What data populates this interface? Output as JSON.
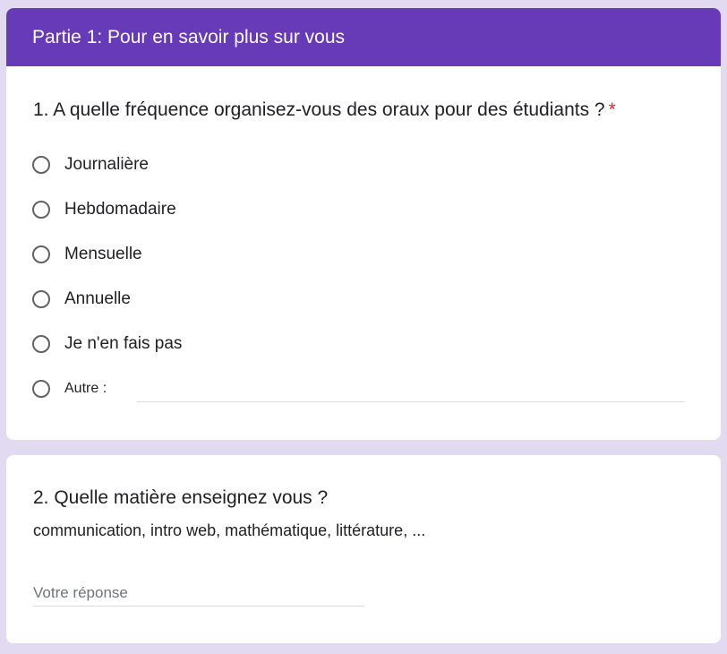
{
  "section": {
    "title": "Partie 1: Pour en savoir plus sur vous"
  },
  "question1": {
    "title": "1. A quelle fréquence organisez-vous des oraux pour des étudiants ?",
    "required_marker": "*",
    "options": [
      {
        "label": "Journalière",
        "selected": false
      },
      {
        "label": "Hebdomadaire",
        "selected": false
      },
      {
        "label": "Mensuelle",
        "selected": false
      },
      {
        "label": "Annuelle",
        "selected": false
      },
      {
        "label": "Je n'en fais pas",
        "selected": false
      }
    ],
    "other": {
      "label": "Autre :",
      "value": ""
    }
  },
  "question2": {
    "title": "2. Quelle matière enseignez vous ?",
    "description": "communication, intro web, mathématique, littérature, ...",
    "answer_placeholder": "Votre réponse",
    "answer_value": ""
  },
  "colors": {
    "header": "#673ab7",
    "background": "#e2daf1",
    "required": "#d93025"
  }
}
